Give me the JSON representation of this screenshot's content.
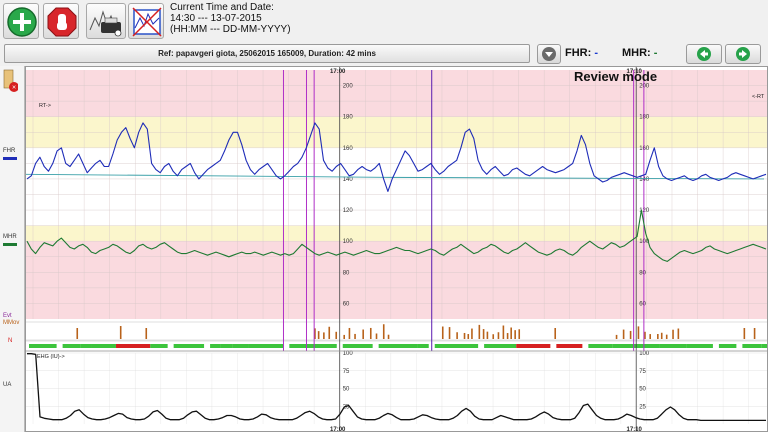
{
  "toolbar": {
    "buttons": [
      {
        "name": "add-icon"
      },
      {
        "name": "stop-hand-icon"
      },
      {
        "name": "printer-icon"
      },
      {
        "name": "zoom-fit-icon"
      }
    ]
  },
  "clock": {
    "label": "Current Time and Date:",
    "time_date": "14:30 --- 13-07-2015",
    "format": "(HH:MM --- DD-MM-YYYY)"
  },
  "info_bar": {
    "ref_text": "Ref: papavgeri giota, 25062015 165009, Duration: 42 mins"
  },
  "readouts": {
    "fhr_label": "FHR:",
    "fhr_value": "-",
    "mhr_label": "MHR:",
    "mhr_value": "-"
  },
  "nav": {
    "prev_icon": "arrow-left-icon",
    "next_icon": "arrow-right-icon"
  },
  "mode_label": "Review mode",
  "side_labels": {
    "fhr": "FHR",
    "mhr": "MHR",
    "event_top": "Evt",
    "mmov": "MMov",
    "n_marker": "N",
    "ua": "UA"
  },
  "colors": {
    "fhr_line": "#1f2db8",
    "mhr_line": "#1e7a32",
    "baseline": "#3aa0a8",
    "marker": "#b030c8",
    "marker_dark": "#5a1ab0",
    "events": "#b8621a",
    "ua_line": "#111111",
    "band_red": "#fadadf",
    "band_yellow": "#fbf6cc",
    "white": "#ffffff"
  },
  "chart_data": {
    "type": "line",
    "time_labels": [
      "17:00",
      "17:10"
    ],
    "top_left_tag": "RT->",
    "top_right_tag": "<-RT",
    "ua_label": "EHG (IU)->",
    "hr_ticks": [
      200,
      180,
      160,
      140,
      120,
      100,
      80,
      60
    ],
    "ua_ticks": [
      100,
      75,
      50,
      25
    ],
    "hr_range": [
      50,
      210
    ],
    "ua_range": [
      0,
      100
    ],
    "marker_times_min": [
      4.9,
      5.35,
      5.5,
      7.8,
      11.75,
      11.95
    ],
    "fhr": [
      140,
      142,
      150,
      154,
      148,
      145,
      150,
      158,
      160,
      150,
      148,
      152,
      156,
      150,
      144,
      147,
      150,
      152,
      148,
      148,
      156,
      165,
      170,
      173,
      166,
      160,
      170,
      176,
      172,
      150,
      146,
      144,
      148,
      150,
      145,
      142,
      146,
      148,
      150,
      144,
      140,
      143,
      146,
      148,
      150,
      152,
      158,
      165,
      170,
      170,
      162,
      152,
      146,
      143,
      146,
      148,
      150,
      146,
      142,
      140,
      142,
      145,
      148,
      150,
      154,
      160,
      168,
      176,
      172,
      152,
      147,
      145,
      148,
      150,
      146,
      142,
      143,
      146,
      148,
      146,
      145,
      147,
      150,
      140,
      132,
      140,
      146,
      152,
      158,
      155,
      150,
      145,
      146,
      148,
      150,
      146,
      143,
      145,
      148,
      150,
      152,
      160,
      170,
      172,
      166,
      152,
      146,
      143,
      146,
      148,
      145,
      142,
      143,
      146,
      147,
      145,
      143,
      142,
      144,
      146,
      148,
      146,
      145,
      144,
      145,
      146,
      148,
      150,
      158,
      168,
      162,
      150,
      142,
      140,
      138,
      139,
      141,
      142,
      143,
      144,
      143,
      142,
      141,
      142,
      143,
      152,
      160,
      148,
      142,
      140,
      139,
      140,
      141,
      142,
      140,
      139,
      140,
      142,
      143,
      141,
      140,
      139,
      140,
      141,
      143,
      144,
      143,
      142,
      141,
      140,
      141,
      142,
      143
    ],
    "mhr": [
      100,
      95,
      92,
      96,
      99,
      98,
      97,
      100,
      102,
      99,
      96,
      95,
      97,
      98,
      96,
      93,
      92,
      94,
      95,
      96,
      98,
      97,
      95,
      93,
      92,
      94,
      97,
      98,
      96,
      95,
      96,
      98,
      99,
      97,
      95,
      93,
      92,
      92,
      93,
      94,
      93,
      92,
      91,
      92,
      93,
      92,
      91,
      90,
      91,
      92,
      93,
      92,
      92,
      93,
      92,
      91,
      92,
      93,
      92,
      91,
      92,
      91,
      92,
      95,
      98,
      96,
      94,
      92,
      91,
      92,
      93,
      92,
      91,
      92,
      93,
      92,
      91,
      92,
      93,
      94,
      93,
      92,
      92,
      93,
      94,
      95,
      96,
      95,
      94,
      94,
      93,
      92,
      93,
      94,
      95,
      94,
      92,
      91,
      93,
      95,
      96,
      98,
      96,
      94,
      92,
      93,
      95,
      96,
      98,
      97,
      95,
      93,
      92,
      94,
      95,
      97,
      99,
      97,
      95,
      93,
      92,
      91,
      92,
      94,
      95,
      94,
      92,
      91,
      93,
      96,
      98,
      100,
      98,
      96,
      95,
      97,
      99,
      98,
      96,
      97,
      99,
      101,
      103,
      120,
      105,
      96,
      92,
      90,
      88,
      87,
      89,
      91,
      93,
      94,
      93,
      92,
      93,
      94,
      96,
      97,
      95,
      94,
      93,
      92,
      93,
      94,
      95,
      96,
      97,
      98,
      97,
      96,
      95
    ],
    "ua": [
      99,
      99,
      98,
      10,
      8,
      7,
      6,
      6,
      6,
      8,
      12,
      18,
      20,
      14,
      9,
      7,
      6,
      6,
      7,
      9,
      12,
      15,
      14,
      9,
      7,
      6,
      6,
      7,
      11,
      17,
      19,
      14,
      8,
      6,
      6,
      6,
      8,
      13,
      17,
      18,
      13,
      8,
      6,
      6,
      7,
      9,
      12,
      12,
      10,
      7,
      6,
      6,
      7,
      10,
      14,
      13,
      9,
      7,
      6,
      6,
      6,
      6,
      8,
      12,
      16,
      18,
      15,
      10,
      7,
      6,
      6,
      7,
      14,
      24,
      26,
      18,
      10,
      7,
      6,
      6,
      6,
      8,
      12,
      15,
      13,
      9,
      6,
      6,
      6,
      7,
      10,
      13,
      12,
      9,
      7,
      6,
      6,
      6,
      8,
      12,
      18,
      22,
      18,
      11,
      7,
      6,
      6,
      6,
      9,
      12,
      10,
      8,
      6,
      6,
      6,
      6,
      7,
      10,
      14,
      17,
      14,
      9,
      7,
      6,
      6,
      6,
      8,
      16,
      26,
      28,
      20,
      12,
      8,
      6,
      6,
      6,
      7,
      10,
      14,
      12,
      9,
      7,
      6,
      6,
      6,
      8,
      14,
      20,
      24,
      20,
      13,
      8,
      6,
      6,
      6,
      5,
      5,
      5,
      5,
      5,
      5,
      5,
      5,
      5,
      5,
      5,
      5,
      5,
      5,
      5,
      5
    ]
  }
}
